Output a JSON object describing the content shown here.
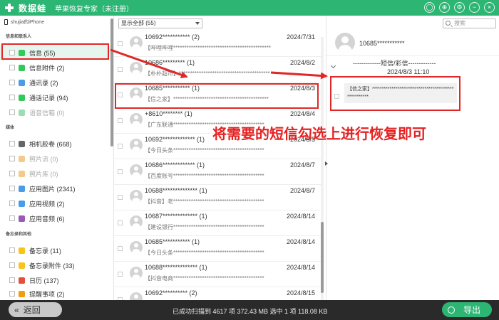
{
  "app": {
    "name": "数据蛙",
    "subtitle": "苹果恢复专家（未注册）"
  },
  "window_buttons": [
    {
      "name": "profile-icon",
      "glyph": "◯"
    },
    {
      "name": "cart-icon",
      "glyph": "⊕"
    },
    {
      "name": "settings-icon",
      "glyph": "⚙"
    },
    {
      "name": "minimize-icon",
      "glyph": "−"
    },
    {
      "name": "close-icon",
      "glyph": "×"
    }
  ],
  "sidebar": {
    "device": "shujia的iPhone",
    "sections": [
      {
        "title": "信息和联系人"
      },
      {
        "title": "媒体"
      },
      {
        "title": "备忘录和其他"
      }
    ],
    "items": [
      {
        "label": "信息 (55)",
        "icon": "message-icon",
        "color": "#34c759"
      },
      {
        "label": "信息附件 (2)",
        "icon": "attachment-icon",
        "color": "#34c759"
      },
      {
        "label": "通讯录 (2)",
        "icon": "contacts-icon",
        "color": "#4a9be8"
      },
      {
        "label": "通话记录 (94)",
        "icon": "call-log-icon",
        "color": "#34c759"
      },
      {
        "label": "语音信箱 (0)",
        "icon": "voicemail-icon",
        "color": "#34c759"
      },
      {
        "label": "相机胶卷 (668)",
        "icon": "camera-roll-icon",
        "color": "#666666"
      },
      {
        "label": "照片流 (0)",
        "icon": "photo-stream-icon",
        "color": "#f5a623"
      },
      {
        "label": "照片库 (0)",
        "icon": "photo-library-icon",
        "color": "#f5a623"
      },
      {
        "label": "应用图片 (2341)",
        "icon": "app-photos-icon",
        "color": "#4a9be8"
      },
      {
        "label": "应用视频 (2)",
        "icon": "app-videos-icon",
        "color": "#4a9be8"
      },
      {
        "label": "应用音频 (6)",
        "icon": "app-audio-icon",
        "color": "#9b59b6"
      },
      {
        "label": "备忘录 (11)",
        "icon": "notes-icon",
        "color": "#f5c518"
      },
      {
        "label": "备忘录附件 (33)",
        "icon": "notes-attachment-icon",
        "color": "#f5c518"
      },
      {
        "label": "日历 (137)",
        "icon": "calendar-icon",
        "color": "#e74c3c"
      },
      {
        "label": "提醒事项 (2)",
        "icon": "reminders-icon",
        "color": "#f39c12"
      }
    ]
  },
  "filter": {
    "value": "显示全部 (55)"
  },
  "messages": [
    {
      "number": "10692*********** (2)",
      "date": "2024/7/31",
      "preview": "【哔哩哔哩********************************************"
    },
    {
      "number": "10686********* (1)",
      "date": "2024/8/2",
      "preview": "【朴朴超市】*****************************************"
    },
    {
      "number": "10685*********** (1)",
      "date": "2024/8/3",
      "preview": "【信之家】*******************************************"
    },
    {
      "number": "+8610******** (1)",
      "date": "2024/8/4",
      "preview": "【广东联通*****************************************"
    },
    {
      "number": "10692************* (1)",
      "date": "2024/8/5",
      "preview": "【今日头条*****************************************"
    },
    {
      "number": "10686************* (1)",
      "date": "2024/8/7",
      "preview": "【百度账号*****************************************"
    },
    {
      "number": "10688************** (1)",
      "date": "2024/8/7",
      "preview": "【抖音】老*****************************************"
    },
    {
      "number": "10687************** (1)",
      "date": "2024/8/14",
      "preview": "【建设银行*****************************************"
    },
    {
      "number": "10685*********** (1)",
      "date": "2024/8/14",
      "preview": "【今日头条*****************************************"
    },
    {
      "number": "10688************** (1)",
      "date": "2024/8/14",
      "preview": "【抖音电商*****************************************"
    },
    {
      "number": "10692********** (2)",
      "date": "2024/8/15",
      "preview": ""
    }
  ],
  "detail": {
    "search_placeholder": "搜索",
    "contact": "10685***********",
    "thread_type": "-------------短信/彩信-------------",
    "thread_date": "2024/8/3 11:10",
    "message": "【信之家】*****************************************************"
  },
  "annotation": "将需要的短信勾选上进行恢复即可",
  "footer": {
    "back_label": "返回",
    "status": "已成功扫描到 4617 项 372.43 MB  选中 1 项 118.08 KB",
    "export_label": "导出"
  },
  "colors": {
    "brand": "#2db574",
    "highlight": "#e02828",
    "footer_bg": "#2a2a2a"
  }
}
